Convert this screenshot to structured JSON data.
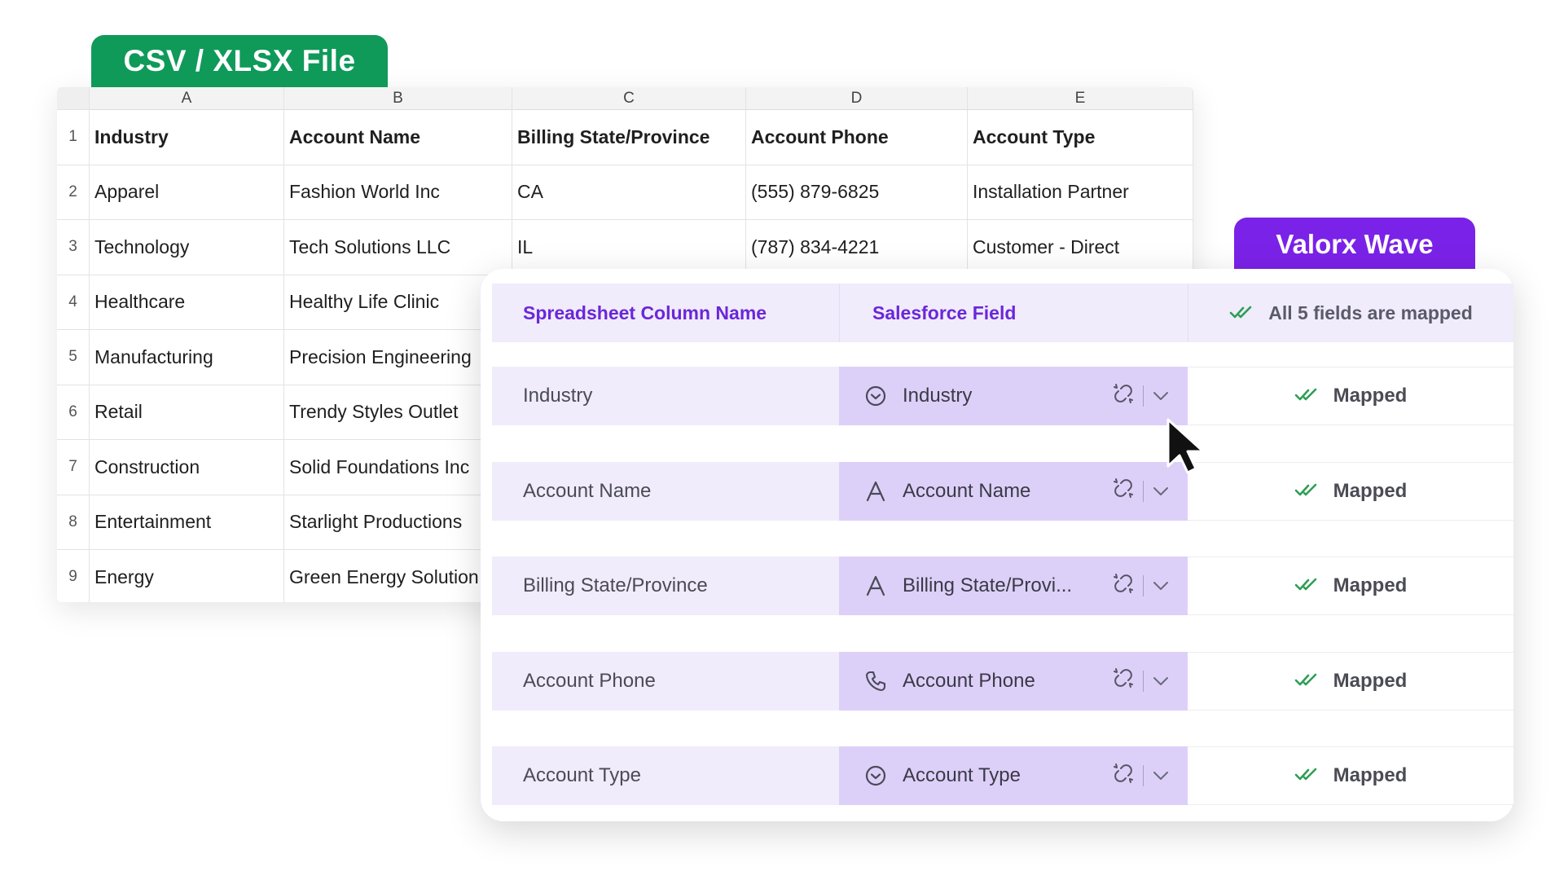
{
  "sheet": {
    "tab_label": "CSV / XLSX File",
    "columns": [
      "A",
      "B",
      "C",
      "D",
      "E"
    ],
    "rows": [
      {
        "num": "1",
        "cells": [
          "Industry",
          "Account Name",
          "Billing State/Province",
          "Account Phone",
          "Account Type"
        ]
      },
      {
        "num": "2",
        "cells": [
          "Apparel",
          "Fashion World Inc",
          "CA",
          "(555) 879-6825",
          "Installation Partner"
        ]
      },
      {
        "num": "3",
        "cells": [
          "Technology",
          "Tech Solutions LLC",
          "IL",
          "(787) 834-4221",
          "Customer - Direct"
        ]
      },
      {
        "num": "4",
        "cells": [
          "Healthcare",
          "Healthy Life Clinic",
          "",
          "",
          ""
        ]
      },
      {
        "num": "5",
        "cells": [
          "Manufacturing",
          "Precision Engineering",
          "",
          "",
          ""
        ]
      },
      {
        "num": "6",
        "cells": [
          "Retail",
          "Trendy Styles Outlet",
          "",
          "",
          ""
        ]
      },
      {
        "num": "7",
        "cells": [
          "Construction",
          "Solid Foundations Inc",
          "",
          "",
          ""
        ]
      },
      {
        "num": "8",
        "cells": [
          "Entertainment",
          "Starlight Productions",
          "",
          "",
          ""
        ]
      },
      {
        "num": "9",
        "cells": [
          "Energy",
          "Green Energy Solution",
          "",
          "",
          ""
        ]
      }
    ]
  },
  "wave": {
    "tab_label": "Valorx Wave",
    "header": {
      "col1": "Spreadsheet Column Name",
      "col2": "Salesforce Field",
      "status": "All 5 fields are mapped"
    },
    "colors": {
      "accent": "#7b22e8",
      "sheet_green": "#0f9a5a",
      "check": "#2e9e55"
    },
    "mappings": [
      {
        "source": "Industry",
        "target": "Industry",
        "icon": "picklist-icon",
        "status": "Mapped"
      },
      {
        "source": "Account Name",
        "target": "Account Name",
        "icon": "text-field-icon",
        "status": "Mapped"
      },
      {
        "source": "Billing State/Province",
        "target": "Billing State/Provi...",
        "icon": "text-field-icon",
        "status": "Mapped"
      },
      {
        "source": "Account Phone",
        "target": "Account Phone",
        "icon": "phone-icon",
        "status": "Mapped"
      },
      {
        "source": "Account Type",
        "target": "Account Type",
        "icon": "picklist-icon",
        "status": "Mapped"
      }
    ]
  }
}
